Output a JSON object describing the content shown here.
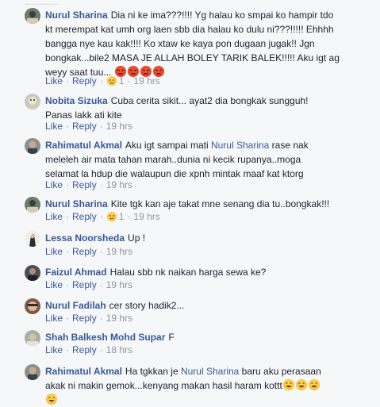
{
  "comments": [
    {
      "author": "Nurul Sharina",
      "text_lines": [
        "Dia ni ke ima???!!!! Yg halau ko smpai ko hampir tdo",
        "kt merempat kat umh org laen sbb dia halau ko dulu ni???!!!!! Ehhhh",
        "bangga nye kau kak!!!! Ko xtaw ke kaya pon dugaan jugak!! Jgn",
        "bongkak...bile2 MASA JE ALLAH BOLEY TARIK BALEK!!!!! Aku igt ag",
        "weyy saat tuu..."
      ],
      "emoji": [
        "angry",
        "angry",
        "angry",
        "angry"
      ],
      "like": "Like",
      "reply": "Reply",
      "reaction_count": "1",
      "time": "19 hrs",
      "has_reaction": true
    },
    {
      "author": "Nobita Sizuka",
      "text_lines": [
        "Cuba cerita sikit... ayat2 dia bongkak sungguh!",
        "Panas lakk ati kite"
      ],
      "like": "Like",
      "reply": "Reply",
      "time": "19 hrs"
    },
    {
      "author": "Rahimatul Akmal",
      "text_lines": [
        "Aku igt sampai mati |Nurul Sharina| rase nak",
        "meleleh air mata tahan marah..dunia ni kecik rupanya..moga",
        "selamat la hdup die walaupun die xpnh mintak maaf kat ktorg"
      ],
      "mention": "Nurul Sharina",
      "line1_before": "Aku igt sampai mati ",
      "line1_after": " rase nak",
      "line2": "meleleh air mata tahan marah..dunia ni kecik rupanya..moga",
      "line3": "selamat la hdup die walaupun die xpnh mintak maaf kat ktorg",
      "like": "Like",
      "reply": "Reply",
      "time": "19 hrs"
    },
    {
      "author": "Nurul Sharina",
      "text": "Kite tgk kan aje takat mne senang dia tu..bongkak!!!",
      "like": "Like",
      "reply": "Reply",
      "reaction_count": "1",
      "time": "19 hrs"
    },
    {
      "author": "Lessa Noorsheda",
      "text": "Up !",
      "like": "Like",
      "reply": "Reply",
      "time": "19 hrs"
    },
    {
      "author": "Faizul Ahmad",
      "text": "Halau sbb nk naikan harga sewa ke?",
      "like": "Like",
      "reply": "Reply",
      "time": "19 hrs"
    },
    {
      "author": "Nurul Fadilah",
      "text": "cer story hadik2...",
      "like": "Like",
      "reply": "Reply",
      "time": "19 hrs"
    },
    {
      "author": "Shah Balkesh Mohd Supar",
      "text": "F",
      "like": "Like",
      "reply": "Reply",
      "time": "18 hrs"
    },
    {
      "author": "Rahimatul Akmal",
      "line1_before": "Ha tgkkan je ",
      "mention": "Nurul Sharina",
      "line1_after": " baru aku perasaan",
      "line2": "akak ni makin gemok...kenyang makan hasil haram kottt",
      "emoji": [
        "laugh",
        "laugh",
        "laugh",
        "laugh"
      ]
    }
  ],
  "colors": {
    "link": "#385898",
    "meta": "#90949c",
    "text": "#1d2129",
    "background": "#f6f7f9"
  }
}
